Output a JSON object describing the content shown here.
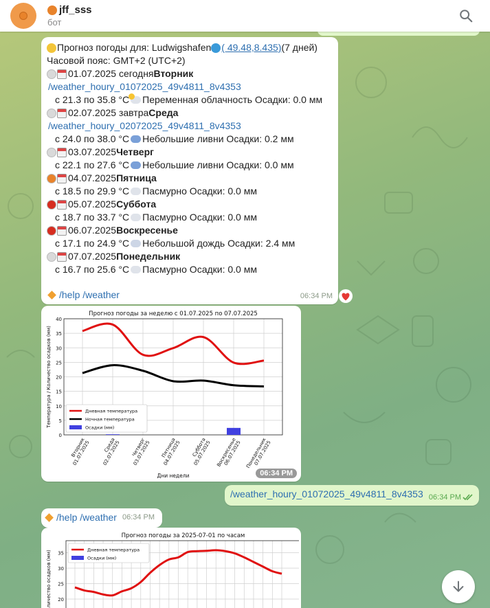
{
  "header": {
    "name": "jff_sss",
    "subtitle": "бот"
  },
  "forecast": {
    "title": "Прогноз погоды для: Ludwigshafen ",
    "coords_link": "( 49.48,8.435)",
    "days_count": " (7 дней)",
    "timezone": "Часовой пояс: GMT+2 (UTC+2)",
    "days": [
      {
        "status": "white",
        "date": "01.07.2025 сегодня ",
        "weekday": "Вторник",
        "link": "/weather_houry_01072025_49v4811_8v4353",
        "line": "с 21.3 по 35.8 °C ",
        "icon": "sun-cloud-icon",
        "desc": "Переменная облачность Осадки: 0.0 мм"
      },
      {
        "status": "white",
        "date": "02.07.2025 завтра ",
        "weekday": "Среда",
        "link": "/weather_houry_02072025_49v4811_8v4353",
        "line": "с 24.0 по 38.0 °C ",
        "icon": "umbrella-icon",
        "desc": "Небольшие ливни Осадки: 0.2 мм"
      },
      {
        "status": "white",
        "date": "03.07.2025  ",
        "weekday": "Четверг",
        "line": "с 22.1 по 27.6 °C ",
        "icon": "umbrella-icon",
        "desc": "Небольшие ливни Осадки: 0.0 мм"
      },
      {
        "status": "orange",
        "date": "04.07.2025  ",
        "weekday": "Пятница",
        "line": "с 18.5 по 29.9 °C ",
        "icon": "cloud-icon",
        "desc": "Пасмурно Осадки: 0.0 мм"
      },
      {
        "status": "red",
        "date": "05.07.2025  ",
        "weekday": "Суббота",
        "line": "с 18.7 по 33.7 °C ",
        "icon": "cloud-icon",
        "desc": "Пасмурно Осадки: 0.0 мм"
      },
      {
        "status": "red",
        "date": "06.07.2025  ",
        "weekday": "Воскресенье",
        "line": "с 17.1 по 24.9 °C ",
        "icon": "rain-cloud-icon",
        "desc": "Небольшой дождь Осадки: 2.4 мм"
      },
      {
        "status": "white",
        "date": "07.07.2025  ",
        "weekday": "Понедельник",
        "line": "с 16.7 по 25.6 °C ",
        "icon": "cloud-icon",
        "desc": "Пасмурно Осадки: 0.0 мм"
      }
    ],
    "footer_links": "/help /weather",
    "time": "06:34 PM"
  },
  "chart_data": [
    {
      "type": "line",
      "title": "Прогноз погоды  за неделю с 01.07.2025 по 07.07.2025",
      "xlabel": "Дни недели",
      "ylabel": "Температура / Количество осадков (мм)",
      "categories": [
        "Вторник\n01.07.2025",
        "Среда\n02.07.2025",
        "Четверг\n03.07.2025",
        "Пятница\n04.07.2025",
        "Суббота\n05.07.2025",
        "Воскресенье\n06.07.2025",
        "Понедельник\n07.07.2025"
      ],
      "ylim": [
        0,
        40
      ],
      "yticks": [
        0,
        5,
        10,
        15,
        20,
        25,
        30,
        35,
        40
      ],
      "series": [
        {
          "name": "Дневная температура",
          "color": "#e01010",
          "values": [
            35.8,
            38.0,
            27.6,
            29.9,
            33.7,
            24.9,
            25.6
          ]
        },
        {
          "name": "Ночная температура",
          "color": "#000000",
          "values": [
            21.3,
            24.0,
            22.1,
            18.5,
            18.7,
            17.1,
            16.7
          ]
        },
        {
          "name": "Осадки (мм)",
          "kind": "bar",
          "color": "#4040e0",
          "values": [
            0.0,
            0.2,
            0.0,
            0.0,
            0.0,
            2.4,
            0.0
          ]
        }
      ],
      "legend": "bottom-left",
      "grid": true,
      "time": "06:34 PM"
    },
    {
      "type": "line",
      "title": "Прогноз погоды  за 2025-07-01 по часам",
      "ylabel": "Количество осадков (мм)",
      "ylim": [
        17,
        38
      ],
      "yticks": [
        20,
        25,
        30,
        35
      ],
      "series": [
        {
          "name": "Дневная температура",
          "color": "#e01010",
          "values": [
            23.8,
            22.8,
            22.3,
            21.5,
            21.2,
            22.5,
            23.5,
            25.5,
            28.5,
            31,
            32.8,
            33.5,
            35.2,
            35.5,
            35.6,
            35.8,
            35.5,
            34.8,
            33.5,
            32,
            30.5,
            29,
            28.2
          ]
        },
        {
          "name": "Осадки (мм)",
          "kind": "bar",
          "color": "#4040e0",
          "values": []
        }
      ],
      "legend": "top-left",
      "grid": true
    }
  ],
  "outgoing": {
    "text": "/weather_houry_01072025_49v4811_8v4353",
    "time": "06:34 PM"
  },
  "reply3": {
    "links": "/help /weather",
    "time": "06:34 PM"
  }
}
